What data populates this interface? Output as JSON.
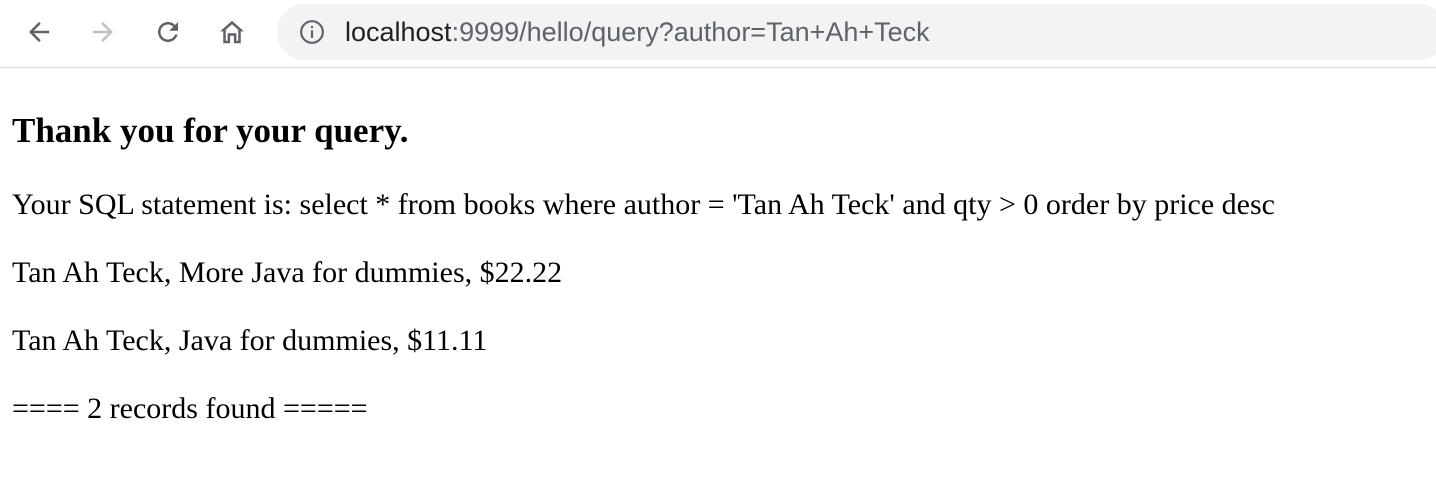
{
  "browser": {
    "back_icon": "arrow-left-icon",
    "forward_icon": "arrow-right-icon",
    "reload_icon": "reload-icon",
    "home_icon": "home-icon",
    "info_icon": "info-icon",
    "url_host": "localhost",
    "url_path": ":9999/hello/query?author=Tan+Ah+Teck",
    "colors": {
      "omnibox_bg": "#f1f3f4",
      "icon_active": "#5f6368",
      "icon_disabled": "#bdc1c6"
    }
  },
  "page": {
    "heading": "Thank you for your query.",
    "sql_statement": "Your SQL statement is: select * from books where author = 'Tan Ah Teck' and qty > 0 order by price desc",
    "records": [
      "Tan Ah Teck, More Java for dummies, $22.22",
      "Tan Ah Teck, Java for dummies, $11.11"
    ],
    "summary": "==== 2 records found ====="
  }
}
